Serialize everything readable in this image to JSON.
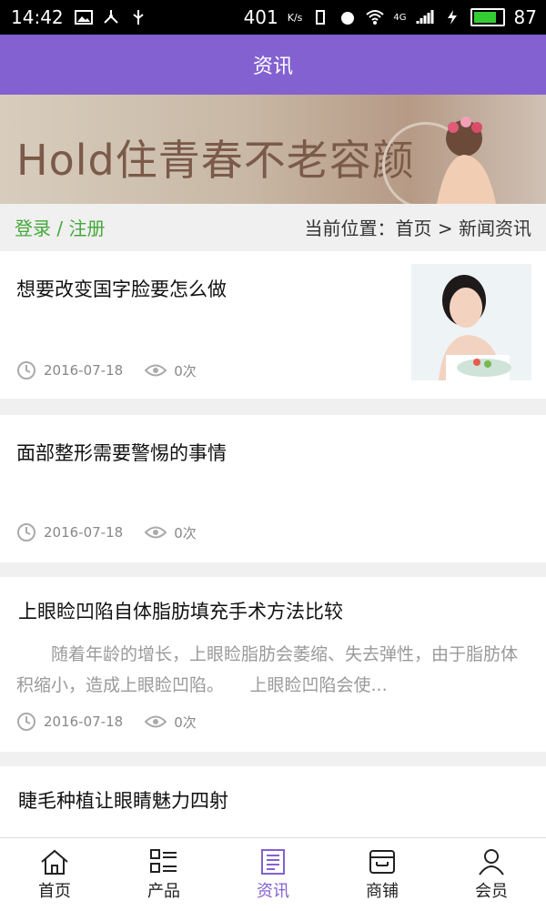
{
  "status_bar": {
    "time": "14:42",
    "net_speed": "401",
    "net_unit": "K/s",
    "signal_label": "4G",
    "battery": "87"
  },
  "app_bar": {
    "title": "资讯"
  },
  "banner": {
    "text": "Hold住青春不老容颜"
  },
  "nav": {
    "login_text": "登录 / 注册",
    "breadcrumb": "当前位置：首页 > 新闻资讯"
  },
  "articles": [
    {
      "title": "想要改变国字脸要怎么做",
      "date": "2016-07-18",
      "views": "0次",
      "excerpt": ""
    },
    {
      "title": "面部整形需要警惕的事情",
      "date": "2016-07-18",
      "views": "0次",
      "excerpt": ""
    },
    {
      "title": "上眼睑凹陷自体脂肪填充手术方法比较",
      "date": "2016-07-18",
      "views": "0次",
      "excerpt": "随着年龄的增长，上眼睑脂肪会萎缩、失去弹性，由于脂肪体积缩小，造成上眼睑凹陷。　　上眼睑凹陷会使..."
    },
    {
      "title": "睫毛种植让眼睛魅力四射",
      "date": "",
      "views": "",
      "excerpt": ""
    }
  ],
  "tabs": [
    {
      "label": "首页",
      "icon": "home-icon"
    },
    {
      "label": "产品",
      "icon": "list-icon"
    },
    {
      "label": "资讯",
      "icon": "news-icon"
    },
    {
      "label": "商铺",
      "icon": "shop-icon"
    },
    {
      "label": "会员",
      "icon": "user-icon"
    }
  ],
  "colors": {
    "accent": "#8461d1",
    "login": "#43a83a"
  }
}
